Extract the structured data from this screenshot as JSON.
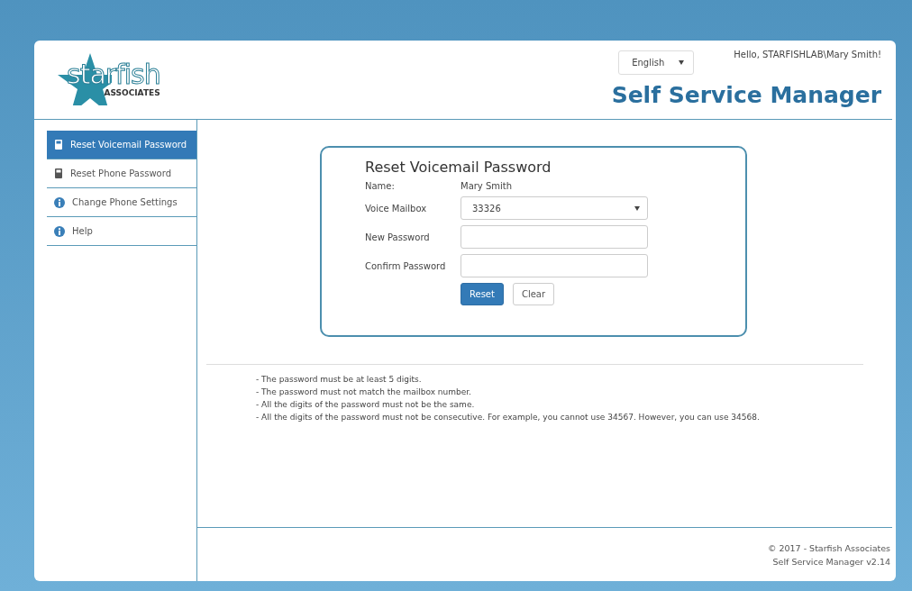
{
  "logo": {
    "word": "starfish",
    "subtitle": "ASSOCIATES"
  },
  "language": {
    "value": "English"
  },
  "greeting": "Hello, STARFISHLAB\\Mary Smith!",
  "app_title": "Self Service Manager",
  "sidebar": {
    "items": [
      {
        "label": "Reset Voicemail Password",
        "kind": "phone",
        "selected": true
      },
      {
        "label": "Reset Phone Password",
        "kind": "phone",
        "selected": false
      },
      {
        "label": "Change Phone Settings",
        "kind": "info",
        "selected": false
      },
      {
        "label": "Help",
        "kind": "info",
        "selected": false
      }
    ]
  },
  "form": {
    "title": "Reset Voicemail Password",
    "fields": [
      {
        "label": "Name:",
        "kind": "text",
        "value": "Mary Smith"
      },
      {
        "label": "Voice Mailbox",
        "kind": "select",
        "value": "33326"
      },
      {
        "label": "New Password",
        "kind": "input"
      },
      {
        "label": "Confirm Password",
        "kind": "input"
      }
    ],
    "buttons": [
      {
        "label": "Reset",
        "kind": "primary"
      },
      {
        "label": "Clear",
        "kind": "default"
      }
    ]
  },
  "rules": [
    "- The password must be at least 5 digits.",
    "- The password must not match the mailbox number.",
    "- All the digits of the password must not be the same.",
    "- All the digits of the password must not be consecutive. For example, you cannot use 34567. However, you can use 34568."
  ],
  "footer": [
    "© 2017 - Starfish Associates",
    "Self Service Manager v2.14"
  ]
}
